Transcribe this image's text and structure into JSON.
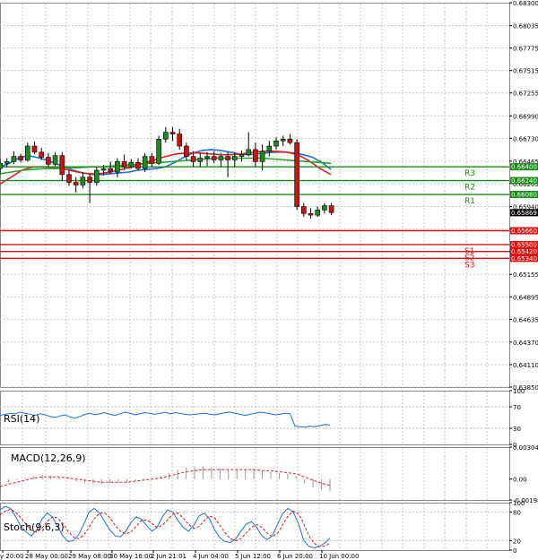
{
  "chart_data": [
    {
      "type": "candlestick",
      "panel": "price",
      "ylim": [
        0.6385,
        0.683
      ],
      "y_ticks": [
        "0.68300",
        "0.68035",
        "0.67775",
        "0.67515",
        "0.67255",
        "0.66990",
        "0.66730",
        "0.66465",
        "0.66205",
        "0.65940",
        "0.65680",
        "0.65420",
        "0.65155",
        "0.64895",
        "0.64635",
        "0.64370",
        "0.64110",
        "0.63850"
      ],
      "x_ticks": [
        "y 20:00",
        "28 May 00:00",
        "29 May 08:00",
        "30 May 16:00",
        "2 Jun 21:01",
        "4 Jun 04:00",
        "5 Jun 12:00",
        "6 Jun 20:00",
        "10 Jun 00:00"
      ],
      "current_price": "0.65869",
      "candles": [
        {
          "o": 0.6638,
          "h": 0.6649,
          "l": 0.6631,
          "c": 0.6644
        },
        {
          "o": 0.6644,
          "h": 0.665,
          "l": 0.664,
          "c": 0.6646
        },
        {
          "o": 0.6646,
          "h": 0.6658,
          "l": 0.6643,
          "c": 0.6652
        },
        {
          "o": 0.6652,
          "h": 0.6655,
          "l": 0.6645,
          "c": 0.6648
        },
        {
          "o": 0.6648,
          "h": 0.6668,
          "l": 0.6646,
          "c": 0.6664
        },
        {
          "o": 0.6664,
          "h": 0.6669,
          "l": 0.6655,
          "c": 0.6657
        },
        {
          "o": 0.6657,
          "h": 0.6662,
          "l": 0.6648,
          "c": 0.6651
        },
        {
          "o": 0.6651,
          "h": 0.6656,
          "l": 0.664,
          "c": 0.6643
        },
        {
          "o": 0.6643,
          "h": 0.6657,
          "l": 0.6641,
          "c": 0.6653
        },
        {
          "o": 0.6653,
          "h": 0.6657,
          "l": 0.6624,
          "c": 0.6631
        },
        {
          "o": 0.6631,
          "h": 0.6636,
          "l": 0.6618,
          "c": 0.6622
        },
        {
          "o": 0.6622,
          "h": 0.6628,
          "l": 0.661,
          "c": 0.6619
        },
        {
          "o": 0.6619,
          "h": 0.6634,
          "l": 0.6615,
          "c": 0.6628
        },
        {
          "o": 0.6628,
          "h": 0.6632,
          "l": 0.6598,
          "c": 0.6622
        },
        {
          "o": 0.6622,
          "h": 0.664,
          "l": 0.6618,
          "c": 0.6636
        },
        {
          "o": 0.6636,
          "h": 0.6642,
          "l": 0.663,
          "c": 0.6638
        },
        {
          "o": 0.6638,
          "h": 0.6646,
          "l": 0.6632,
          "c": 0.6634
        },
        {
          "o": 0.6634,
          "h": 0.665,
          "l": 0.6628,
          "c": 0.6646
        },
        {
          "o": 0.6646,
          "h": 0.6654,
          "l": 0.6636,
          "c": 0.664
        },
        {
          "o": 0.664,
          "h": 0.6649,
          "l": 0.6638,
          "c": 0.6645
        },
        {
          "o": 0.6645,
          "h": 0.665,
          "l": 0.6636,
          "c": 0.6638
        },
        {
          "o": 0.6638,
          "h": 0.6656,
          "l": 0.6634,
          "c": 0.6652
        },
        {
          "o": 0.6652,
          "h": 0.6656,
          "l": 0.664,
          "c": 0.6644
        },
        {
          "o": 0.6644,
          "h": 0.6676,
          "l": 0.6642,
          "c": 0.6672
        },
        {
          "o": 0.6672,
          "h": 0.6686,
          "l": 0.6668,
          "c": 0.668
        },
        {
          "o": 0.668,
          "h": 0.6686,
          "l": 0.667,
          "c": 0.6678
        },
        {
          "o": 0.6678,
          "h": 0.6684,
          "l": 0.666,
          "c": 0.6664
        },
        {
          "o": 0.6664,
          "h": 0.6668,
          "l": 0.6648,
          "c": 0.6652
        },
        {
          "o": 0.6652,
          "h": 0.6658,
          "l": 0.664,
          "c": 0.6646
        },
        {
          "o": 0.6646,
          "h": 0.6656,
          "l": 0.664,
          "c": 0.665
        },
        {
          "o": 0.665,
          "h": 0.6657,
          "l": 0.6641,
          "c": 0.6652
        },
        {
          "o": 0.6652,
          "h": 0.6658,
          "l": 0.6644,
          "c": 0.6648
        },
        {
          "o": 0.6648,
          "h": 0.6656,
          "l": 0.664,
          "c": 0.6652
        },
        {
          "o": 0.6652,
          "h": 0.6657,
          "l": 0.6628,
          "c": 0.6648
        },
        {
          "o": 0.6648,
          "h": 0.6656,
          "l": 0.664,
          "c": 0.6652
        },
        {
          "o": 0.6652,
          "h": 0.6659,
          "l": 0.6646,
          "c": 0.6654
        },
        {
          "o": 0.6654,
          "h": 0.668,
          "l": 0.6652,
          "c": 0.666
        },
        {
          "o": 0.666,
          "h": 0.6668,
          "l": 0.664,
          "c": 0.6646
        },
        {
          "o": 0.6646,
          "h": 0.6666,
          "l": 0.6636,
          "c": 0.6658
        },
        {
          "o": 0.6658,
          "h": 0.667,
          "l": 0.6652,
          "c": 0.6664
        },
        {
          "o": 0.6664,
          "h": 0.6674,
          "l": 0.666,
          "c": 0.667
        },
        {
          "o": 0.667,
          "h": 0.6676,
          "l": 0.6664,
          "c": 0.6672
        },
        {
          "o": 0.6672,
          "h": 0.6678,
          "l": 0.6666,
          "c": 0.6668
        },
        {
          "o": 0.6668,
          "h": 0.6672,
          "l": 0.659,
          "c": 0.6594
        },
        {
          "o": 0.6594,
          "h": 0.6598,
          "l": 0.6582,
          "c": 0.6586
        },
        {
          "o": 0.6586,
          "h": 0.6592,
          "l": 0.658,
          "c": 0.6584
        },
        {
          "o": 0.6584,
          "h": 0.6594,
          "l": 0.6582,
          "c": 0.659
        },
        {
          "o": 0.659,
          "h": 0.6598,
          "l": 0.6586,
          "c": 0.6595
        },
        {
          "o": 0.6595,
          "h": 0.6598,
          "l": 0.6584,
          "c": 0.6587
        }
      ],
      "moving_averages": [
        {
          "color": "#1e6fe0",
          "values": [
            0.664,
            0.6644,
            0.665,
            0.6653,
            0.6651,
            0.6648,
            0.6644,
            0.664,
            0.6636,
            0.6633,
            0.6631,
            0.6631,
            0.6632,
            0.6633,
            0.6634,
            0.6636,
            0.6637,
            0.6638,
            0.664,
            0.6645,
            0.6651,
            0.6656,
            0.6659,
            0.666,
            0.6659,
            0.6657,
            0.6655,
            0.6654,
            0.6655,
            0.6656,
            0.6657,
            0.6657,
            0.6656,
            0.6654,
            0.6651,
            0.6645,
            0.6637
          ]
        },
        {
          "color": "#dd2222",
          "values": [
            0.662,
            0.6628,
            0.6636,
            0.664,
            0.664,
            0.6639,
            0.6637,
            0.6634,
            0.6632,
            0.6632,
            0.6634,
            0.6637,
            0.664,
            0.6644,
            0.6648,
            0.6652,
            0.6655,
            0.6656,
            0.6656,
            0.6655,
            0.6654,
            0.6654,
            0.6655,
            0.6657,
            0.6658,
            0.6658,
            0.6657,
            0.6654,
            0.6647,
            0.6638,
            0.6631
          ]
        },
        {
          "color": "#2fa02f",
          "values": [
            0.6632,
            0.6634,
            0.6636,
            0.6637,
            0.6638,
            0.6638,
            0.6639,
            0.6639,
            0.664,
            0.664,
            0.6641,
            0.6642,
            0.6643,
            0.6644,
            0.6645,
            0.6646,
            0.6647,
            0.6648,
            0.6649,
            0.665,
            0.665,
            0.665,
            0.665,
            0.665,
            0.6649,
            0.6648,
            0.6647,
            0.6646,
            0.6645,
            0.6644
          ]
        }
      ],
      "levels": [
        {
          "name": "R3",
          "value": 0.664,
          "tag": "0.66400",
          "color": "#1a8c1a"
        },
        {
          "name": "R2",
          "value": 0.6624,
          "tag": "0.66240",
          "color": "#1a8c1a"
        },
        {
          "name": "R1",
          "value": 0.6608,
          "tag": "0.66080",
          "color": "#1a8c1a"
        },
        {
          "name": "",
          "value": 0.6566,
          "tag": "0.65660",
          "color": "#e01010"
        },
        {
          "name": "S1",
          "value": 0.655,
          "tag": "0.65500",
          "color": "#e01010"
        },
        {
          "name": "S2",
          "value": 0.6542,
          "tag": "0.65420",
          "color": "#e01010"
        },
        {
          "name": "S3",
          "value": 0.6534,
          "tag": "0.65340",
          "color": "#e01010"
        }
      ]
    },
    {
      "type": "line",
      "panel": "rsi",
      "title": "RSI(14)",
      "ylim": [
        0,
        100
      ],
      "y_ticks": [
        "100",
        "70",
        "30",
        "0"
      ],
      "values": [
        54,
        56,
        58,
        57,
        60,
        58,
        56,
        54,
        57,
        55,
        52,
        50,
        53,
        55,
        51,
        49,
        52,
        56,
        58,
        55,
        57,
        59,
        56,
        54,
        57,
        60,
        58,
        55,
        57,
        59,
        58,
        56,
        58,
        60,
        57,
        59,
        58,
        56,
        55,
        56,
        57,
        58,
        56,
        55,
        57,
        59,
        60,
        58,
        56,
        54,
        56,
        58,
        60,
        59,
        57,
        55,
        56,
        58,
        57,
        34,
        33,
        32,
        34,
        33,
        35,
        37,
        36
      ]
    },
    {
      "type": "bar",
      "panel": "macd",
      "title": "MACD(12,26,9)",
      "y_ticks": [
        "0.003042",
        "0.00",
        "-0.001988"
      ],
      "histogram": [
        -0.0005,
        -0.0003,
        -0.0001,
        0.0001,
        0.0003,
        0.0004,
        0.0003,
        0.0002,
        0.0,
        -0.0002,
        -0.0004,
        -0.0005,
        -0.0005,
        -0.0004,
        -0.0003,
        -0.0003,
        -0.0002,
        -0.0001,
        0.0001,
        0.0003,
        0.0006,
        0.0009,
        0.0011,
        0.0012,
        0.0012,
        0.0011,
        0.001,
        0.0009,
        0.0009,
        0.0009,
        0.0009,
        0.0008,
        0.0007,
        0.0006,
        0.0005,
        0.0003,
        -0.0004,
        -0.0008,
        -0.001,
        -0.0011
      ],
      "signal": [
        -0.0007,
        -0.0005,
        -0.0003,
        -0.0001,
        0.0001,
        0.0002,
        0.0002,
        0.0002,
        0.0001,
        0.0,
        -0.0001,
        -0.0002,
        -0.0003,
        -0.0003,
        -0.0003,
        -0.0003,
        -0.0002,
        -0.0001,
        0.0,
        0.0001,
        0.0003,
        0.0005,
        0.0007,
        0.0008,
        0.0009,
        0.0009,
        0.0009,
        0.0009,
        0.0009,
        0.0009,
        0.0009,
        0.0008,
        0.0008,
        0.0007,
        0.0006,
        0.0005,
        0.0002,
        -0.0001,
        -0.0004,
        -0.0006
      ]
    },
    {
      "type": "line",
      "panel": "stoch",
      "title": "Stoch(9,6,3)",
      "y_ticks": [
        "100",
        "80",
        "20",
        "0"
      ],
      "series": [
        {
          "color": "#1e6fe0",
          "values": [
            85,
            92,
            88,
            70,
            50,
            38,
            30,
            42,
            65,
            78,
            70,
            50,
            30,
            18,
            20,
            32,
            55,
            80,
            88,
            78,
            60,
            42,
            30,
            28,
            40,
            58,
            70,
            65,
            52,
            40,
            48,
            70,
            85,
            80,
            62,
            48,
            40,
            52,
            72,
            78,
            66,
            42,
            26,
            18,
            16,
            24,
            40,
            55,
            60,
            48,
            30,
            22,
            30,
            55,
            78,
            88,
            80,
            55,
            20,
            8,
            5,
            8,
            15,
            25
          ]
        },
        {
          "color": "#e01010",
          "values": [
            75,
            82,
            86,
            80,
            68,
            54,
            42,
            38,
            46,
            60,
            70,
            68,
            56,
            40,
            28,
            24,
            32,
            48,
            66,
            78,
            78,
            68,
            52,
            40,
            34,
            38,
            50,
            62,
            64,
            56,
            48,
            52,
            64,
            76,
            78,
            68,
            54,
            46,
            50,
            62,
            72,
            68,
            52,
            36,
            24,
            20,
            24,
            36,
            48,
            54,
            48,
            36,
            28,
            36,
            54,
            72,
            82,
            76,
            56,
            30,
            14,
            8,
            9,
            14
          ]
        }
      ]
    }
  ]
}
